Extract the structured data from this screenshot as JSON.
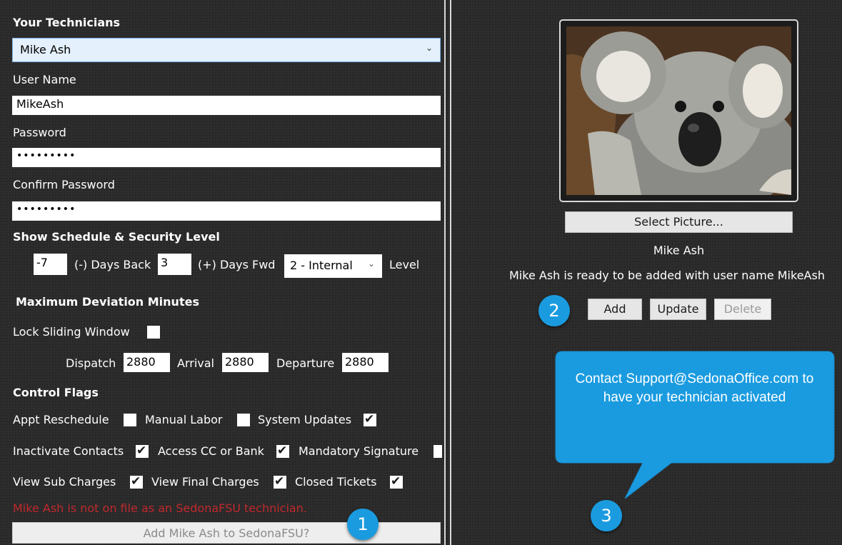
{
  "form": {
    "section_title": "Your Technicians",
    "technician_select_value": "Mike Ash",
    "username_label": "User Name",
    "username_value": "MikeAsh",
    "password_label": "Password",
    "password_mask": "•••••••••",
    "confirm_label": "Confirm Password",
    "confirm_mask": "•••••••••",
    "schedule_heading": "Show Schedule & Security Level",
    "days_back_value": "-7",
    "days_back_label": "(-) Days Back",
    "days_fwd_value": "3",
    "days_fwd_label": "(+) Days Fwd",
    "security_level_value": "2 - Internal",
    "level_label": "Level",
    "deviation_heading": "Maximum Deviation Minutes",
    "lock_window_label": "Lock Sliding Window",
    "lock_window_checked": false,
    "dispatch_label": "Dispatch",
    "dispatch_value": "2880",
    "arrival_label": "Arrival",
    "arrival_value": "2880",
    "departure_label": "Departure",
    "departure_value": "2880",
    "flags_heading": "Control Flags",
    "flags": {
      "appt_reschedule": {
        "label": "Appt Reschedule",
        "checked": false
      },
      "manual_labor": {
        "label": "Manual Labor",
        "checked": false
      },
      "system_updates": {
        "label": "System Updates",
        "checked": true
      },
      "inactivate_contacts": {
        "label": "Inactivate Contacts",
        "checked": true
      },
      "access_cc_bank": {
        "label": "Access CC or Bank",
        "checked": true
      },
      "mandatory_signature": {
        "label": "Mandatory Signature",
        "checked": false
      },
      "view_sub_charges": {
        "label": "View Sub Charges",
        "checked": true
      },
      "view_final_charges": {
        "label": "View Final Charges",
        "checked": true
      },
      "closed_tickets": {
        "label": "Closed Tickets",
        "checked": true
      }
    },
    "error_message": "Mike Ash is not on file as an SedonaFSU technician.",
    "add_to_fsu_button": "Add Mike Ash to SedonaFSU?"
  },
  "profile": {
    "select_picture_button": "Select Picture...",
    "name": "Mike Ash",
    "status_message": "Mike Ash is ready to be added with user name MikeAsh",
    "add_button": "Add",
    "update_button": "Update",
    "delete_button": "Delete"
  },
  "callouts": {
    "badge_1": "1",
    "badge_2": "2",
    "badge_3": "3",
    "tooltip_text": "Contact Support@SedonaOffice.com to have your technician activated"
  },
  "colors": {
    "background": "#2d2d2d",
    "error_text": "#c0282d",
    "callout_blue": "#1a9be0",
    "select_bg": "#e4f0fb"
  }
}
